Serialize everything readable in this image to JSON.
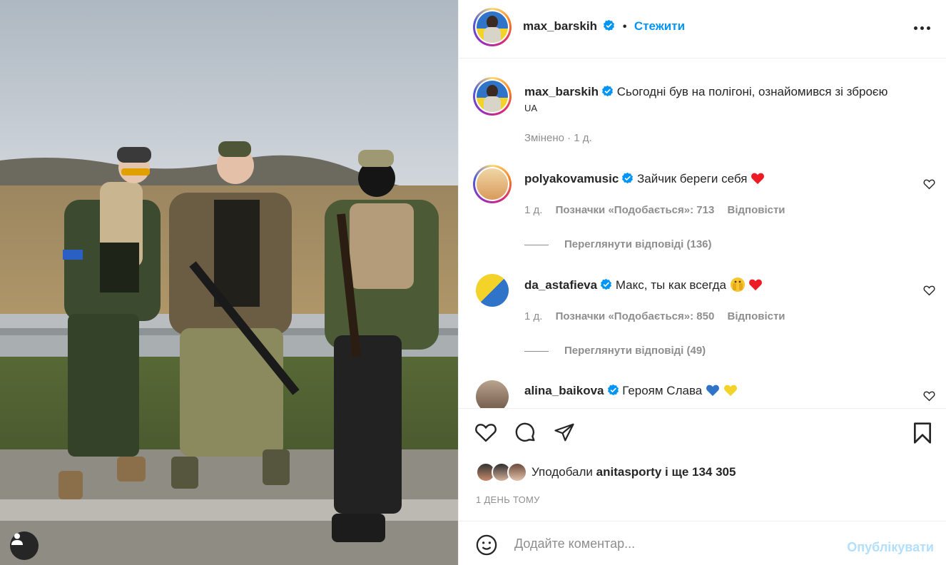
{
  "post": {
    "author": "max_barskih",
    "follow_label": "Стежити",
    "separator": "•",
    "caption": "Сьогодні був на полігоні, ознайомився зі зброєю",
    "caption_tag": "UA",
    "edited_meta": "Змінено · 1 д."
  },
  "comments": [
    {
      "user": "polyakovamusic",
      "text": "Зайчик береги себя",
      "age": "1 д.",
      "likes": "Позначки «Подобається»: 713",
      "reply_label": "Відповісти",
      "view_replies": "Переглянути відповіді (136)"
    },
    {
      "user": "da_astafieva",
      "text": "Макс, ты как всегда",
      "age": "1 д.",
      "likes": "Позначки «Подобається»: 850",
      "reply_label": "Відповісти",
      "view_replies": "Переглянути відповіді (49)"
    },
    {
      "user": "alina_baikova",
      "text": "Героям Слава"
    }
  ],
  "likes": {
    "prefix": "Уподобали",
    "user": "anitasporty",
    "rest": "і ще 134 305"
  },
  "timestamp": "1 ДЕНЬ ТОМУ",
  "composer": {
    "placeholder": "Додайте коментар...",
    "publish_label": "Опублікувати"
  },
  "colors": {
    "accent": "#0095f6",
    "publish_disabled": "#b2dffc",
    "heart_red": "#ed1c24",
    "ukraine_blue": "#2f74c9",
    "ukraine_yellow": "#f3d22a"
  }
}
